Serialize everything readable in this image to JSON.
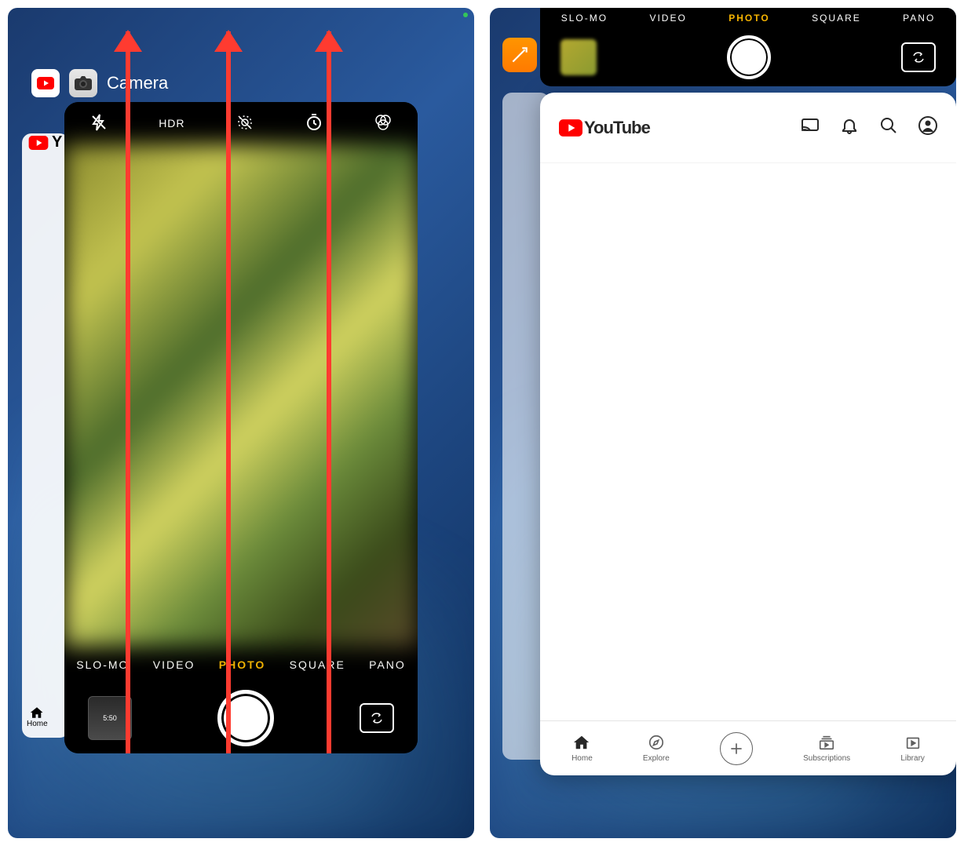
{
  "left": {
    "app_switcher": {
      "active_app_label": "Camera",
      "background_card_label": "Y",
      "background_tab_label": "Home"
    },
    "camera": {
      "top_bar": {
        "hdr": "HDR"
      },
      "modes": {
        "slomo": "SLO-MO",
        "video": "VIDEO",
        "photo": "PHOTO",
        "square": "SQUARE",
        "pano": "PANO"
      },
      "thumb_time": "5:50"
    }
  },
  "right": {
    "camera_strip": {
      "modes": {
        "slomo": "SLO-MO",
        "video": "VIDEO",
        "photo": "PHOTO",
        "square": "SQUARE",
        "pano": "PANO"
      }
    },
    "youtube": {
      "brand": "YouTube",
      "tabs": {
        "home": "Home",
        "explore": "Explore",
        "subscriptions": "Subscriptions",
        "library": "Library"
      }
    }
  }
}
